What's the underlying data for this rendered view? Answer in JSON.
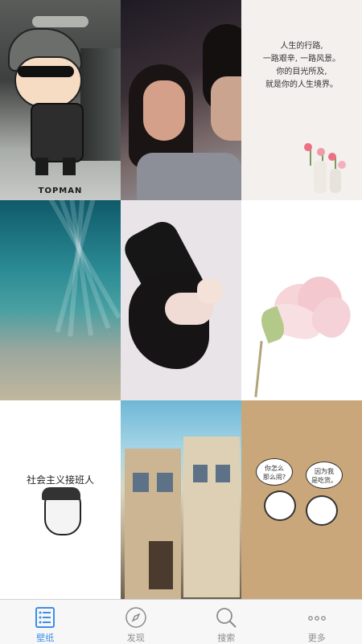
{
  "wallpapers": [
    {
      "caption": "TOPMAN"
    },
    {},
    {
      "quote_lines": [
        "人生的行路,",
        "一路艰辛, 一路风景。",
        "你的目光所及,",
        "就是你的人生境界。"
      ]
    },
    {},
    {},
    {},
    {
      "caption": "社会主义接班人"
    },
    {},
    {
      "bubble_left": "你怎么\n那么闹?",
      "bubble_right": "因为我\n是吃货。"
    }
  ],
  "tabbar": {
    "items": [
      {
        "label": "壁纸",
        "icon": "list-icon",
        "active": true
      },
      {
        "label": "发现",
        "icon": "compass-icon",
        "active": false
      },
      {
        "label": "搜索",
        "icon": "search-icon",
        "active": false
      },
      {
        "label": "更多",
        "icon": "more-icon",
        "active": false
      }
    ]
  },
  "colors": {
    "accent": "#3d8ee8",
    "inactive": "#8c8c8c",
    "tabbar_bg": "#f7f7f7"
  }
}
